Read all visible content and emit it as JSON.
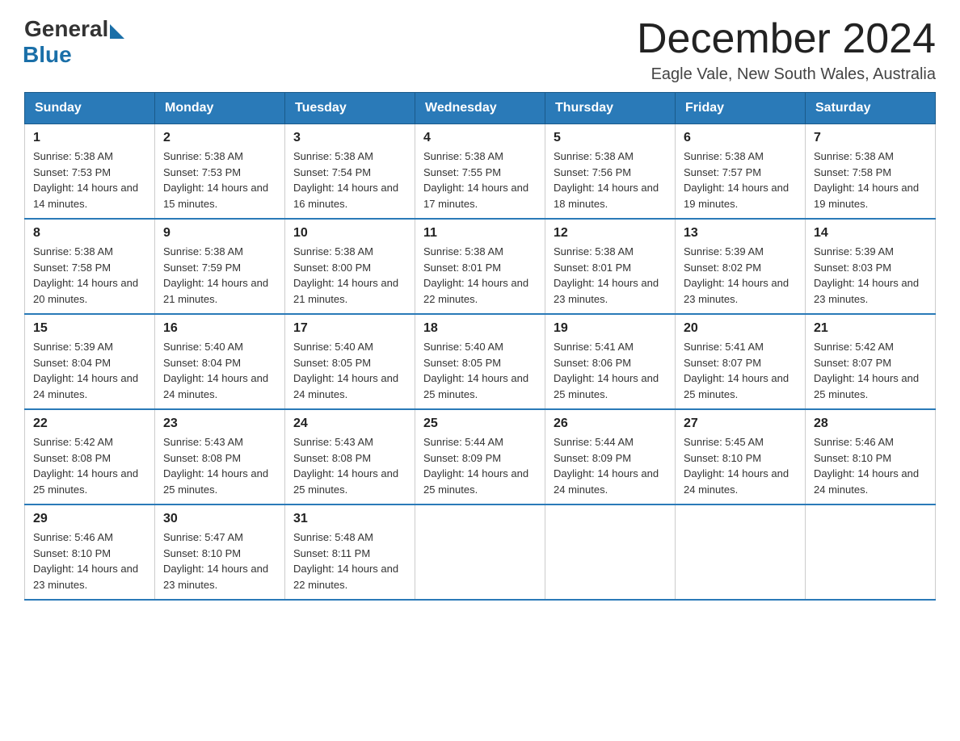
{
  "header": {
    "logo_general": "General",
    "logo_blue": "Blue",
    "main_title": "December 2024",
    "subtitle": "Eagle Vale, New South Wales, Australia"
  },
  "calendar": {
    "days_of_week": [
      "Sunday",
      "Monday",
      "Tuesday",
      "Wednesday",
      "Thursday",
      "Friday",
      "Saturday"
    ],
    "weeks": [
      [
        {
          "day": "1",
          "sunrise": "5:38 AM",
          "sunset": "7:53 PM",
          "daylight": "14 hours and 14 minutes."
        },
        {
          "day": "2",
          "sunrise": "5:38 AM",
          "sunset": "7:53 PM",
          "daylight": "14 hours and 15 minutes."
        },
        {
          "day": "3",
          "sunrise": "5:38 AM",
          "sunset": "7:54 PM",
          "daylight": "14 hours and 16 minutes."
        },
        {
          "day": "4",
          "sunrise": "5:38 AM",
          "sunset": "7:55 PM",
          "daylight": "14 hours and 17 minutes."
        },
        {
          "day": "5",
          "sunrise": "5:38 AM",
          "sunset": "7:56 PM",
          "daylight": "14 hours and 18 minutes."
        },
        {
          "day": "6",
          "sunrise": "5:38 AM",
          "sunset": "7:57 PM",
          "daylight": "14 hours and 19 minutes."
        },
        {
          "day": "7",
          "sunrise": "5:38 AM",
          "sunset": "7:58 PM",
          "daylight": "14 hours and 19 minutes."
        }
      ],
      [
        {
          "day": "8",
          "sunrise": "5:38 AM",
          "sunset": "7:58 PM",
          "daylight": "14 hours and 20 minutes."
        },
        {
          "day": "9",
          "sunrise": "5:38 AM",
          "sunset": "7:59 PM",
          "daylight": "14 hours and 21 minutes."
        },
        {
          "day": "10",
          "sunrise": "5:38 AM",
          "sunset": "8:00 PM",
          "daylight": "14 hours and 21 minutes."
        },
        {
          "day": "11",
          "sunrise": "5:38 AM",
          "sunset": "8:01 PM",
          "daylight": "14 hours and 22 minutes."
        },
        {
          "day": "12",
          "sunrise": "5:38 AM",
          "sunset": "8:01 PM",
          "daylight": "14 hours and 23 minutes."
        },
        {
          "day": "13",
          "sunrise": "5:39 AM",
          "sunset": "8:02 PM",
          "daylight": "14 hours and 23 minutes."
        },
        {
          "day": "14",
          "sunrise": "5:39 AM",
          "sunset": "8:03 PM",
          "daylight": "14 hours and 23 minutes."
        }
      ],
      [
        {
          "day": "15",
          "sunrise": "5:39 AM",
          "sunset": "8:04 PM",
          "daylight": "14 hours and 24 minutes."
        },
        {
          "day": "16",
          "sunrise": "5:40 AM",
          "sunset": "8:04 PM",
          "daylight": "14 hours and 24 minutes."
        },
        {
          "day": "17",
          "sunrise": "5:40 AM",
          "sunset": "8:05 PM",
          "daylight": "14 hours and 24 minutes."
        },
        {
          "day": "18",
          "sunrise": "5:40 AM",
          "sunset": "8:05 PM",
          "daylight": "14 hours and 25 minutes."
        },
        {
          "day": "19",
          "sunrise": "5:41 AM",
          "sunset": "8:06 PM",
          "daylight": "14 hours and 25 minutes."
        },
        {
          "day": "20",
          "sunrise": "5:41 AM",
          "sunset": "8:07 PM",
          "daylight": "14 hours and 25 minutes."
        },
        {
          "day": "21",
          "sunrise": "5:42 AM",
          "sunset": "8:07 PM",
          "daylight": "14 hours and 25 minutes."
        }
      ],
      [
        {
          "day": "22",
          "sunrise": "5:42 AM",
          "sunset": "8:08 PM",
          "daylight": "14 hours and 25 minutes."
        },
        {
          "day": "23",
          "sunrise": "5:43 AM",
          "sunset": "8:08 PM",
          "daylight": "14 hours and 25 minutes."
        },
        {
          "day": "24",
          "sunrise": "5:43 AM",
          "sunset": "8:08 PM",
          "daylight": "14 hours and 25 minutes."
        },
        {
          "day": "25",
          "sunrise": "5:44 AM",
          "sunset": "8:09 PM",
          "daylight": "14 hours and 25 minutes."
        },
        {
          "day": "26",
          "sunrise": "5:44 AM",
          "sunset": "8:09 PM",
          "daylight": "14 hours and 24 minutes."
        },
        {
          "day": "27",
          "sunrise": "5:45 AM",
          "sunset": "8:10 PM",
          "daylight": "14 hours and 24 minutes."
        },
        {
          "day": "28",
          "sunrise": "5:46 AM",
          "sunset": "8:10 PM",
          "daylight": "14 hours and 24 minutes."
        }
      ],
      [
        {
          "day": "29",
          "sunrise": "5:46 AM",
          "sunset": "8:10 PM",
          "daylight": "14 hours and 23 minutes."
        },
        {
          "day": "30",
          "sunrise": "5:47 AM",
          "sunset": "8:10 PM",
          "daylight": "14 hours and 23 minutes."
        },
        {
          "day": "31",
          "sunrise": "5:48 AM",
          "sunset": "8:11 PM",
          "daylight": "14 hours and 22 minutes."
        },
        null,
        null,
        null,
        null
      ]
    ]
  }
}
